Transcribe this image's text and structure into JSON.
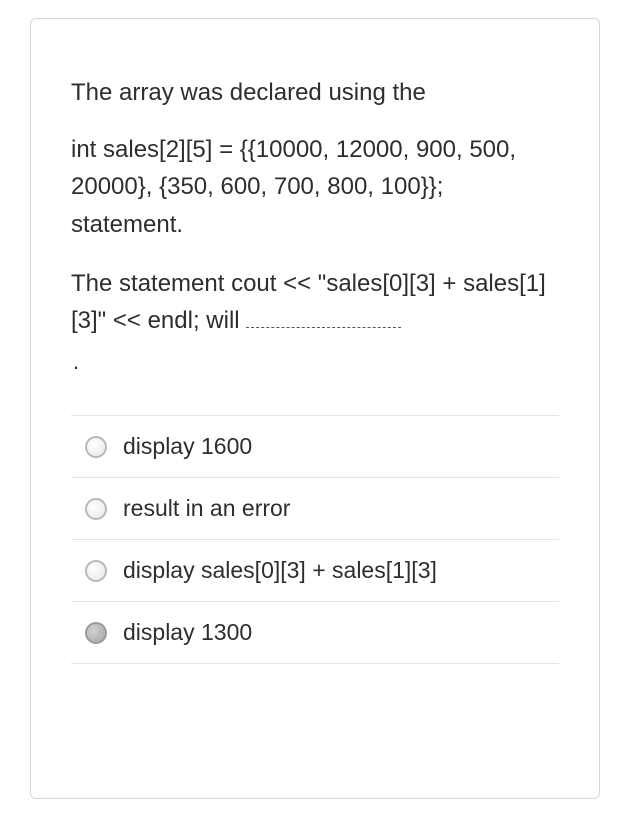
{
  "question": {
    "line1": "The array was declared using the",
    "line2": "int sales[2][5] = {{10000,  12000, 900, 500, 20000}, {350, 600, 700, 800, 100}}; statement.",
    "line3_prefix": "The statement cout << \"sales[0][3] + sales[1][3]\" << endl; will",
    "dot": "."
  },
  "options": [
    {
      "label": "display 1600",
      "selected": false
    },
    {
      "label": "result in an error",
      "selected": false
    },
    {
      "label": "display sales[0][3] + sales[1][3]",
      "selected": false
    },
    {
      "label": "display 1300",
      "selected": true
    }
  ]
}
